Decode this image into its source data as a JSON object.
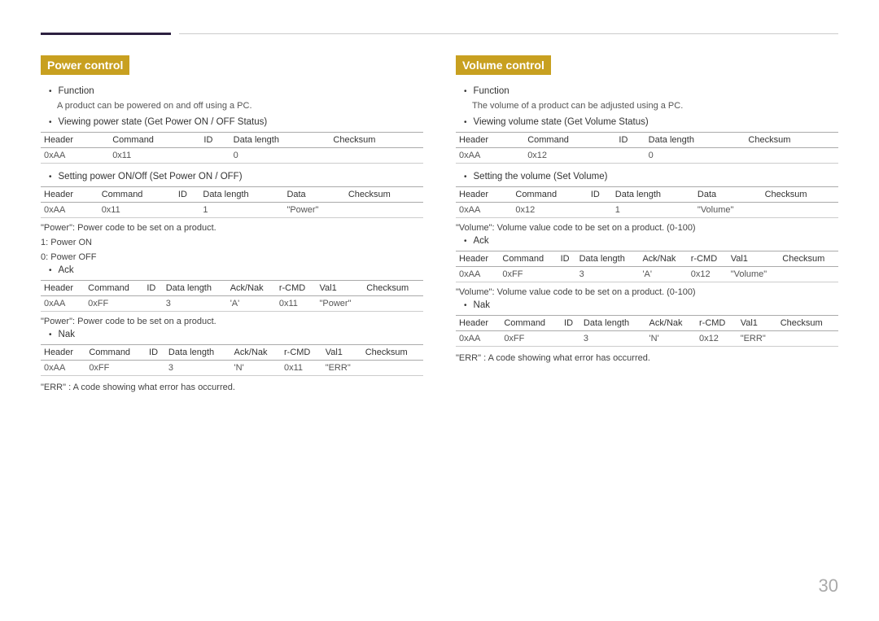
{
  "page": {
    "number": "30",
    "top_line_exists": true
  },
  "left_section": {
    "title": "Power control",
    "function_label": "Function",
    "function_desc": "A product can be powered on and off using a PC.",
    "viewing_label": "Viewing power state (Get Power ON / OFF Status)",
    "table1": {
      "headers": [
        "Header",
        "Command",
        "ID",
        "Data length",
        "Checksum"
      ],
      "rows": [
        [
          "0xAA",
          "0x11",
          "",
          "0",
          ""
        ]
      ]
    },
    "setting_label": "Setting power ON/Off (Set Power ON / OFF)",
    "table2": {
      "headers": [
        "Header",
        "Command",
        "ID",
        "Data length",
        "Data",
        "Checksum"
      ],
      "rows": [
        [
          "0xAA",
          "0x11",
          "",
          "1",
          "\"Power\"",
          ""
        ]
      ]
    },
    "note1": "\"Power\": Power code to be set on a product.",
    "note2": "1: Power ON",
    "note3": "0: Power OFF",
    "ack_label": "Ack",
    "table3": {
      "headers": [
        "Header",
        "Command",
        "ID",
        "Data length",
        "Ack/Nak",
        "r-CMD",
        "Val1",
        "Checksum"
      ],
      "rows": [
        [
          "0xAA",
          "0xFF",
          "",
          "3",
          "'A'",
          "0x11",
          "\"Power\"",
          ""
        ]
      ]
    },
    "note4": "\"Power\": Power code to be set on a product.",
    "nak_label": "Nak",
    "table4": {
      "headers": [
        "Header",
        "Command",
        "ID",
        "Data length",
        "Ack/Nak",
        "r-CMD",
        "Val1",
        "Checksum"
      ],
      "rows": [
        [
          "0xAA",
          "0xFF",
          "",
          "3",
          "'N'",
          "0x11",
          "\"ERR\"",
          ""
        ]
      ]
    },
    "err_note": "\"ERR\" : A code showing what error has occurred."
  },
  "right_section": {
    "title": "Volume control",
    "function_label": "Function",
    "function_desc": "The volume of a product can be adjusted using a PC.",
    "viewing_label": "Viewing volume state (Get Volume Status)",
    "table1": {
      "headers": [
        "Header",
        "Command",
        "ID",
        "Data length",
        "Checksum"
      ],
      "rows": [
        [
          "0xAA",
          "0x12",
          "",
          "0",
          ""
        ]
      ]
    },
    "setting_label": "Setting the volume (Set Volume)",
    "table2": {
      "headers": [
        "Header",
        "Command",
        "ID",
        "Data length",
        "Data",
        "Checksum"
      ],
      "rows": [
        [
          "0xAA",
          "0x12",
          "",
          "1",
          "\"Volume\"",
          ""
        ]
      ]
    },
    "note1": "\"Volume\": Volume value code to be set on a product. (0-100)",
    "ack_label": "Ack",
    "table3": {
      "headers": [
        "Header",
        "Command",
        "ID",
        "Data length",
        "Ack/Nak",
        "r-CMD",
        "Val1",
        "Checksum"
      ],
      "rows": [
        [
          "0xAA",
          "0xFF",
          "",
          "3",
          "'A'",
          "0x12",
          "\"Volume\"",
          ""
        ]
      ]
    },
    "note2": "\"Volume\": Volume value code to be set on a product. (0-100)",
    "nak_label": "Nak",
    "table4": {
      "headers": [
        "Header",
        "Command",
        "ID",
        "Data length",
        "Ack/Nak",
        "r-CMD",
        "Val1",
        "Checksum"
      ],
      "rows": [
        [
          "0xAA",
          "0xFF",
          "",
          "3",
          "'N'",
          "0x12",
          "\"ERR\"",
          ""
        ]
      ]
    },
    "err_note": "\"ERR\" : A code showing what error has occurred."
  }
}
